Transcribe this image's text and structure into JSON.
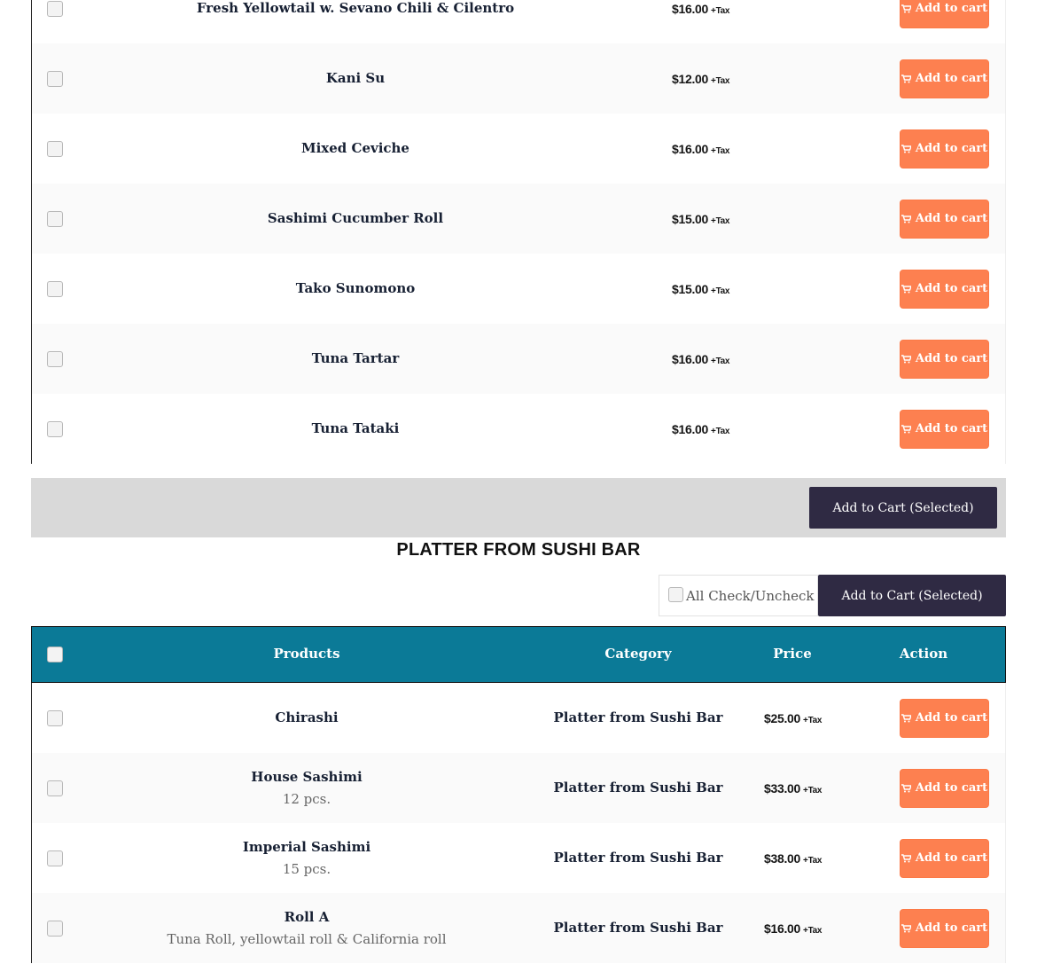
{
  "colors": {
    "accent": "#fd8050",
    "dark_button": "#2f2a43",
    "table_header": "#0b7a97",
    "selection_bar": "#d9d9d9"
  },
  "add_to_cart_label": "Add to cart",
  "tax_label": "+Tax",
  "selected_button_label": "Add to Cart (Selected)",
  "previous_section": {
    "items": [
      {
        "name": "Fresh Yellowtail w. Sevano Chili & Cilentro",
        "price": "$16.00"
      },
      {
        "name": "Kani Su",
        "price": "$12.00"
      },
      {
        "name": "Mixed Ceviche",
        "price": "$16.00"
      },
      {
        "name": "Sashimi Cucumber Roll",
        "price": "$15.00"
      },
      {
        "name": "Tako Sunomono",
        "price": "$15.00"
      },
      {
        "name": "Tuna Tartar",
        "price": "$16.00"
      },
      {
        "name": "Tuna Tataki",
        "price": "$16.00"
      }
    ]
  },
  "platter_section": {
    "title": "PLATTER FROM SUSHI BAR",
    "check_all_label": "All Check/Uncheck",
    "headers": {
      "products": "Products",
      "category": "Category",
      "price": "Price",
      "action": "Action"
    },
    "items": [
      {
        "name": "Chirashi",
        "desc": "",
        "category": "Platter from Sushi Bar",
        "price": "$25.00"
      },
      {
        "name": "House Sashimi",
        "desc": "12 pcs.",
        "category": "Platter from Sushi Bar",
        "price": "$33.00"
      },
      {
        "name": "Imperial Sashimi",
        "desc": "15 pcs.",
        "category": "Platter from Sushi Bar",
        "price": "$38.00"
      },
      {
        "name": "Roll A",
        "desc": "Tuna Roll, yellowtail roll & California roll",
        "category": "Platter from Sushi Bar",
        "price": "$16.00"
      }
    ]
  }
}
